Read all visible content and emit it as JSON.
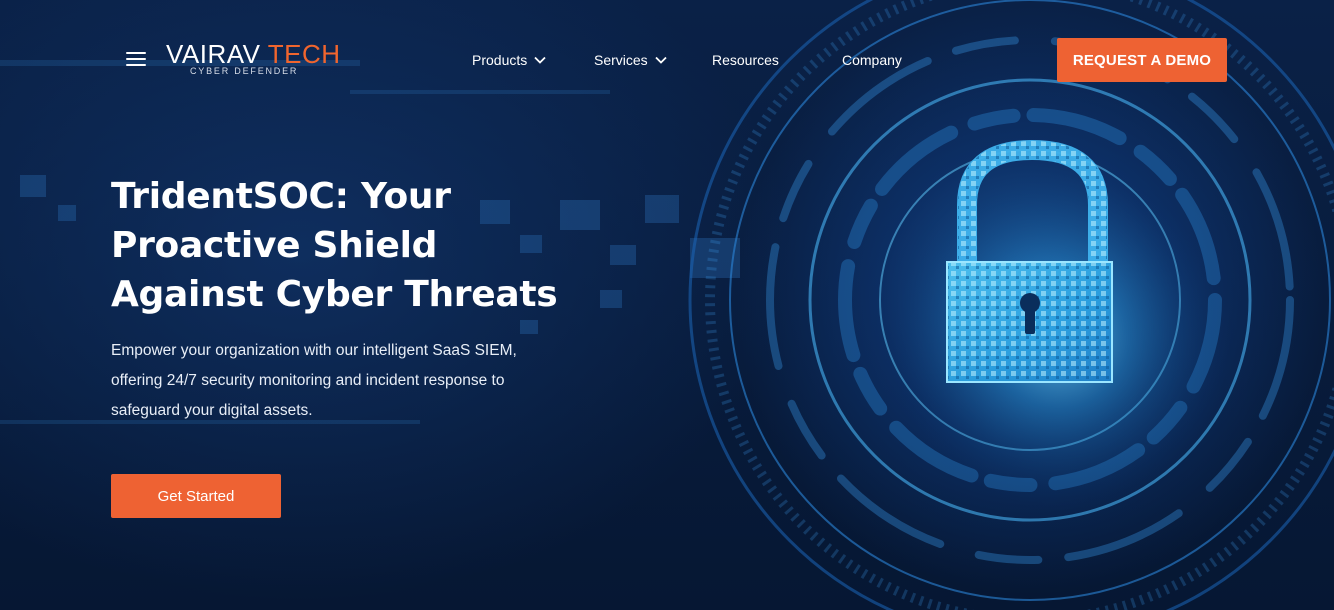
{
  "brand": {
    "name_part1": "VAIRAV",
    "name_part2": "TECH",
    "tagline": "CYBER DEFENDER",
    "accent_color": "#ee6233"
  },
  "header": {
    "menu_icon": "hamburger-menu-icon",
    "nav": [
      {
        "label": "Products",
        "has_dropdown": true
      },
      {
        "label": "Services",
        "has_dropdown": true
      },
      {
        "label": "Resources",
        "has_dropdown": false
      },
      {
        "label": "Company",
        "has_dropdown": false
      }
    ],
    "cta_label": "REQUEST A DEMO"
  },
  "hero": {
    "headline_lines": [
      "TridentSOC: Your",
      "Proactive Shield",
      "Against Cyber Threats"
    ],
    "description_lines": [
      "Empower your organization with our intelligent SaaS SIEM,",
      "offering 24/7 security monitoring and incident response to",
      "safeguard your digital assets."
    ],
    "button_label": "Get Started",
    "illustration": "padlock-circuit-icon"
  }
}
